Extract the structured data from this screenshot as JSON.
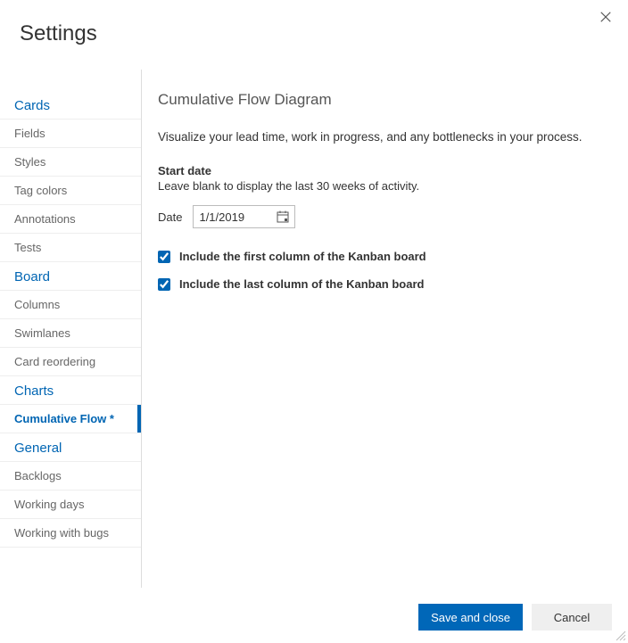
{
  "dialog": {
    "title": "Settings"
  },
  "sidebar": {
    "sections": [
      {
        "header": "Cards",
        "items": [
          "Fields",
          "Styles",
          "Tag colors",
          "Annotations",
          "Tests"
        ]
      },
      {
        "header": "Board",
        "items": [
          "Columns",
          "Swimlanes",
          "Card reordering"
        ]
      },
      {
        "header": "Charts",
        "items": [
          "Cumulative Flow *"
        ]
      },
      {
        "header": "General",
        "items": [
          "Backlogs",
          "Working days",
          "Working with bugs"
        ]
      }
    ],
    "active": "Cumulative Flow *"
  },
  "content": {
    "heading": "Cumulative Flow Diagram",
    "description": "Visualize your lead time, work in progress, and any bottlenecks in your process.",
    "startDate": {
      "label": "Start date",
      "hint": "Leave blank to display the last 30 weeks of activity.",
      "fieldLabel": "Date",
      "value": "1/1/2019"
    },
    "options": {
      "includeFirst": {
        "label": "Include the first column of the Kanban board",
        "checked": true
      },
      "includeLast": {
        "label": "Include the last column of the Kanban board",
        "checked": true
      }
    }
  },
  "footer": {
    "save": "Save and close",
    "cancel": "Cancel"
  }
}
